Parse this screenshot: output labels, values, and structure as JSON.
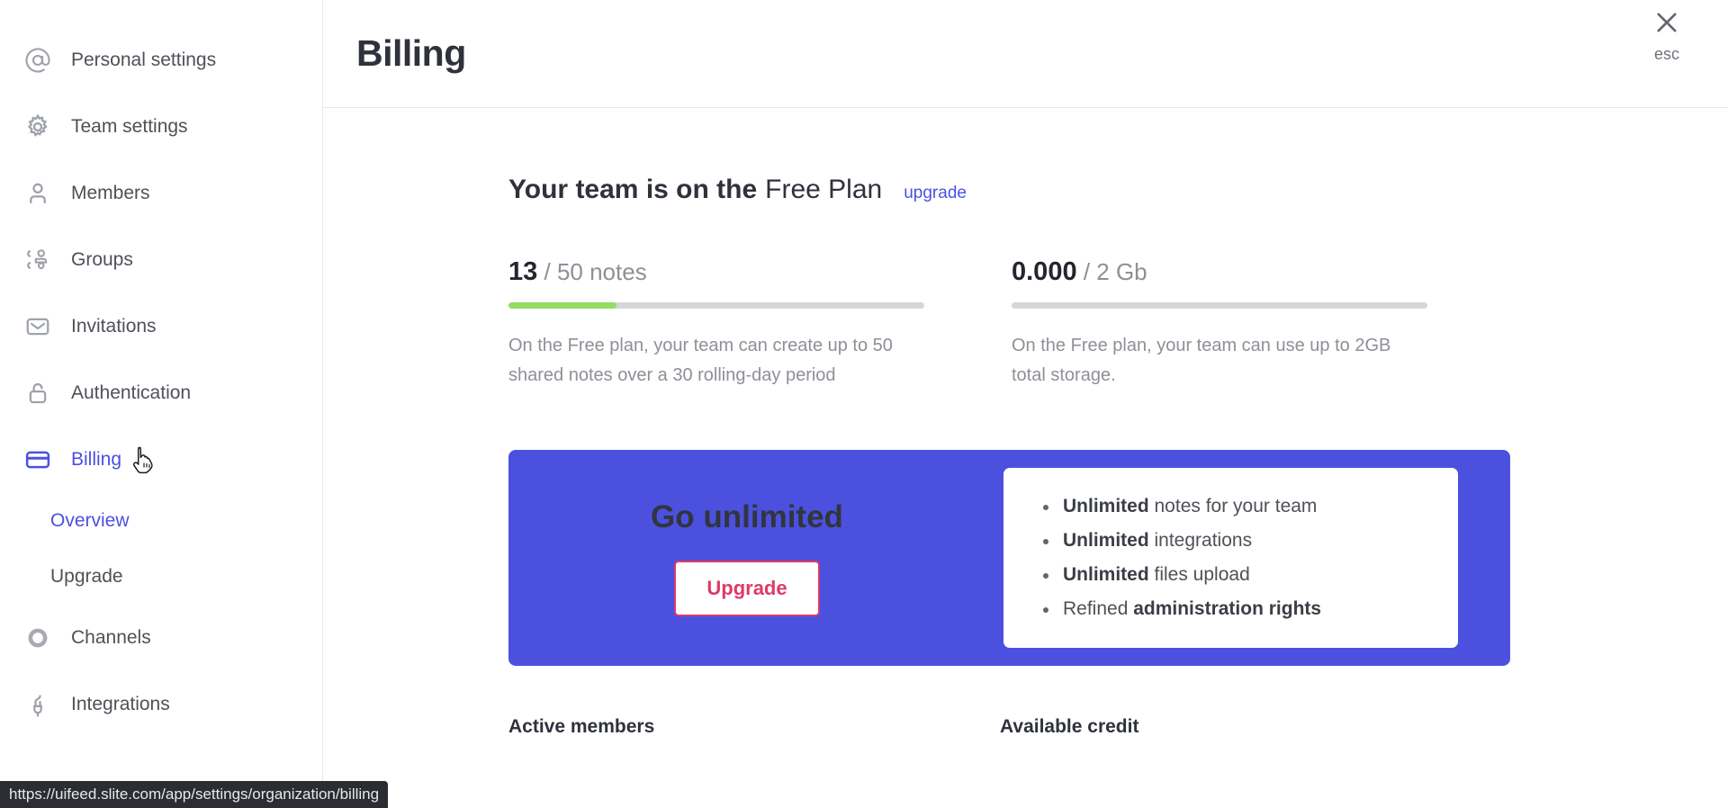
{
  "sidebar": {
    "items": [
      {
        "label": "Personal settings",
        "icon": "at-icon",
        "active": false
      },
      {
        "label": "Team settings",
        "icon": "gear-icon",
        "active": false
      },
      {
        "label": "Members",
        "icon": "user-icon",
        "active": false
      },
      {
        "label": "Groups",
        "icon": "users-icon",
        "active": false
      },
      {
        "label": "Invitations",
        "icon": "envelope-icon",
        "active": false
      },
      {
        "label": "Authentication",
        "icon": "unlock-icon",
        "active": false
      },
      {
        "label": "Billing",
        "icon": "credit-card-icon",
        "active": true
      },
      {
        "label": "Channels",
        "icon": "circle-icon",
        "active": false
      },
      {
        "label": "Integrations",
        "icon": "plug-icon",
        "active": false
      }
    ],
    "sub_items": [
      {
        "label": "Overview",
        "active": true
      },
      {
        "label": "Upgrade",
        "active": false
      }
    ]
  },
  "header": {
    "title": "Billing",
    "close_icon": "close-icon",
    "esc_label": "esc"
  },
  "plan": {
    "prefix": "Your team is on the",
    "name": "Free Plan",
    "upgrade_link": "upgrade"
  },
  "usage": [
    {
      "value": "13",
      "limit": "/ 50 notes",
      "percent": 26,
      "fill_color": "#93dd63",
      "description": "On the Free plan, your team can create up to 50 shared notes over a 30 rolling-day period"
    },
    {
      "value": "0.000",
      "limit": "/ 2 Gb",
      "percent": 0,
      "fill_color": "#93dd63",
      "description": "On the Free plan, your team can use up to 2GB total storage."
    }
  ],
  "banner": {
    "background_color": "#4b51de",
    "title": "Go unlimited",
    "button_label": "Upgrade",
    "button_color": "#dd3a68",
    "features": [
      {
        "bold": "Unlimited",
        "rest": " notes for your team",
        "bold_first": true
      },
      {
        "bold": "Unlimited",
        "rest": " integrations",
        "bold_first": true
      },
      {
        "bold": "Unlimited",
        "rest": " files upload",
        "bold_first": true
      },
      {
        "bold": "administration rights",
        "rest": "Refined ",
        "bold_first": false
      }
    ]
  },
  "bottom": {
    "active_members_label": "Active members",
    "available_credit_label": "Available credit"
  },
  "statusbar": {
    "url": "https://uifeed.slite.com/app/settings/organization/billing"
  }
}
